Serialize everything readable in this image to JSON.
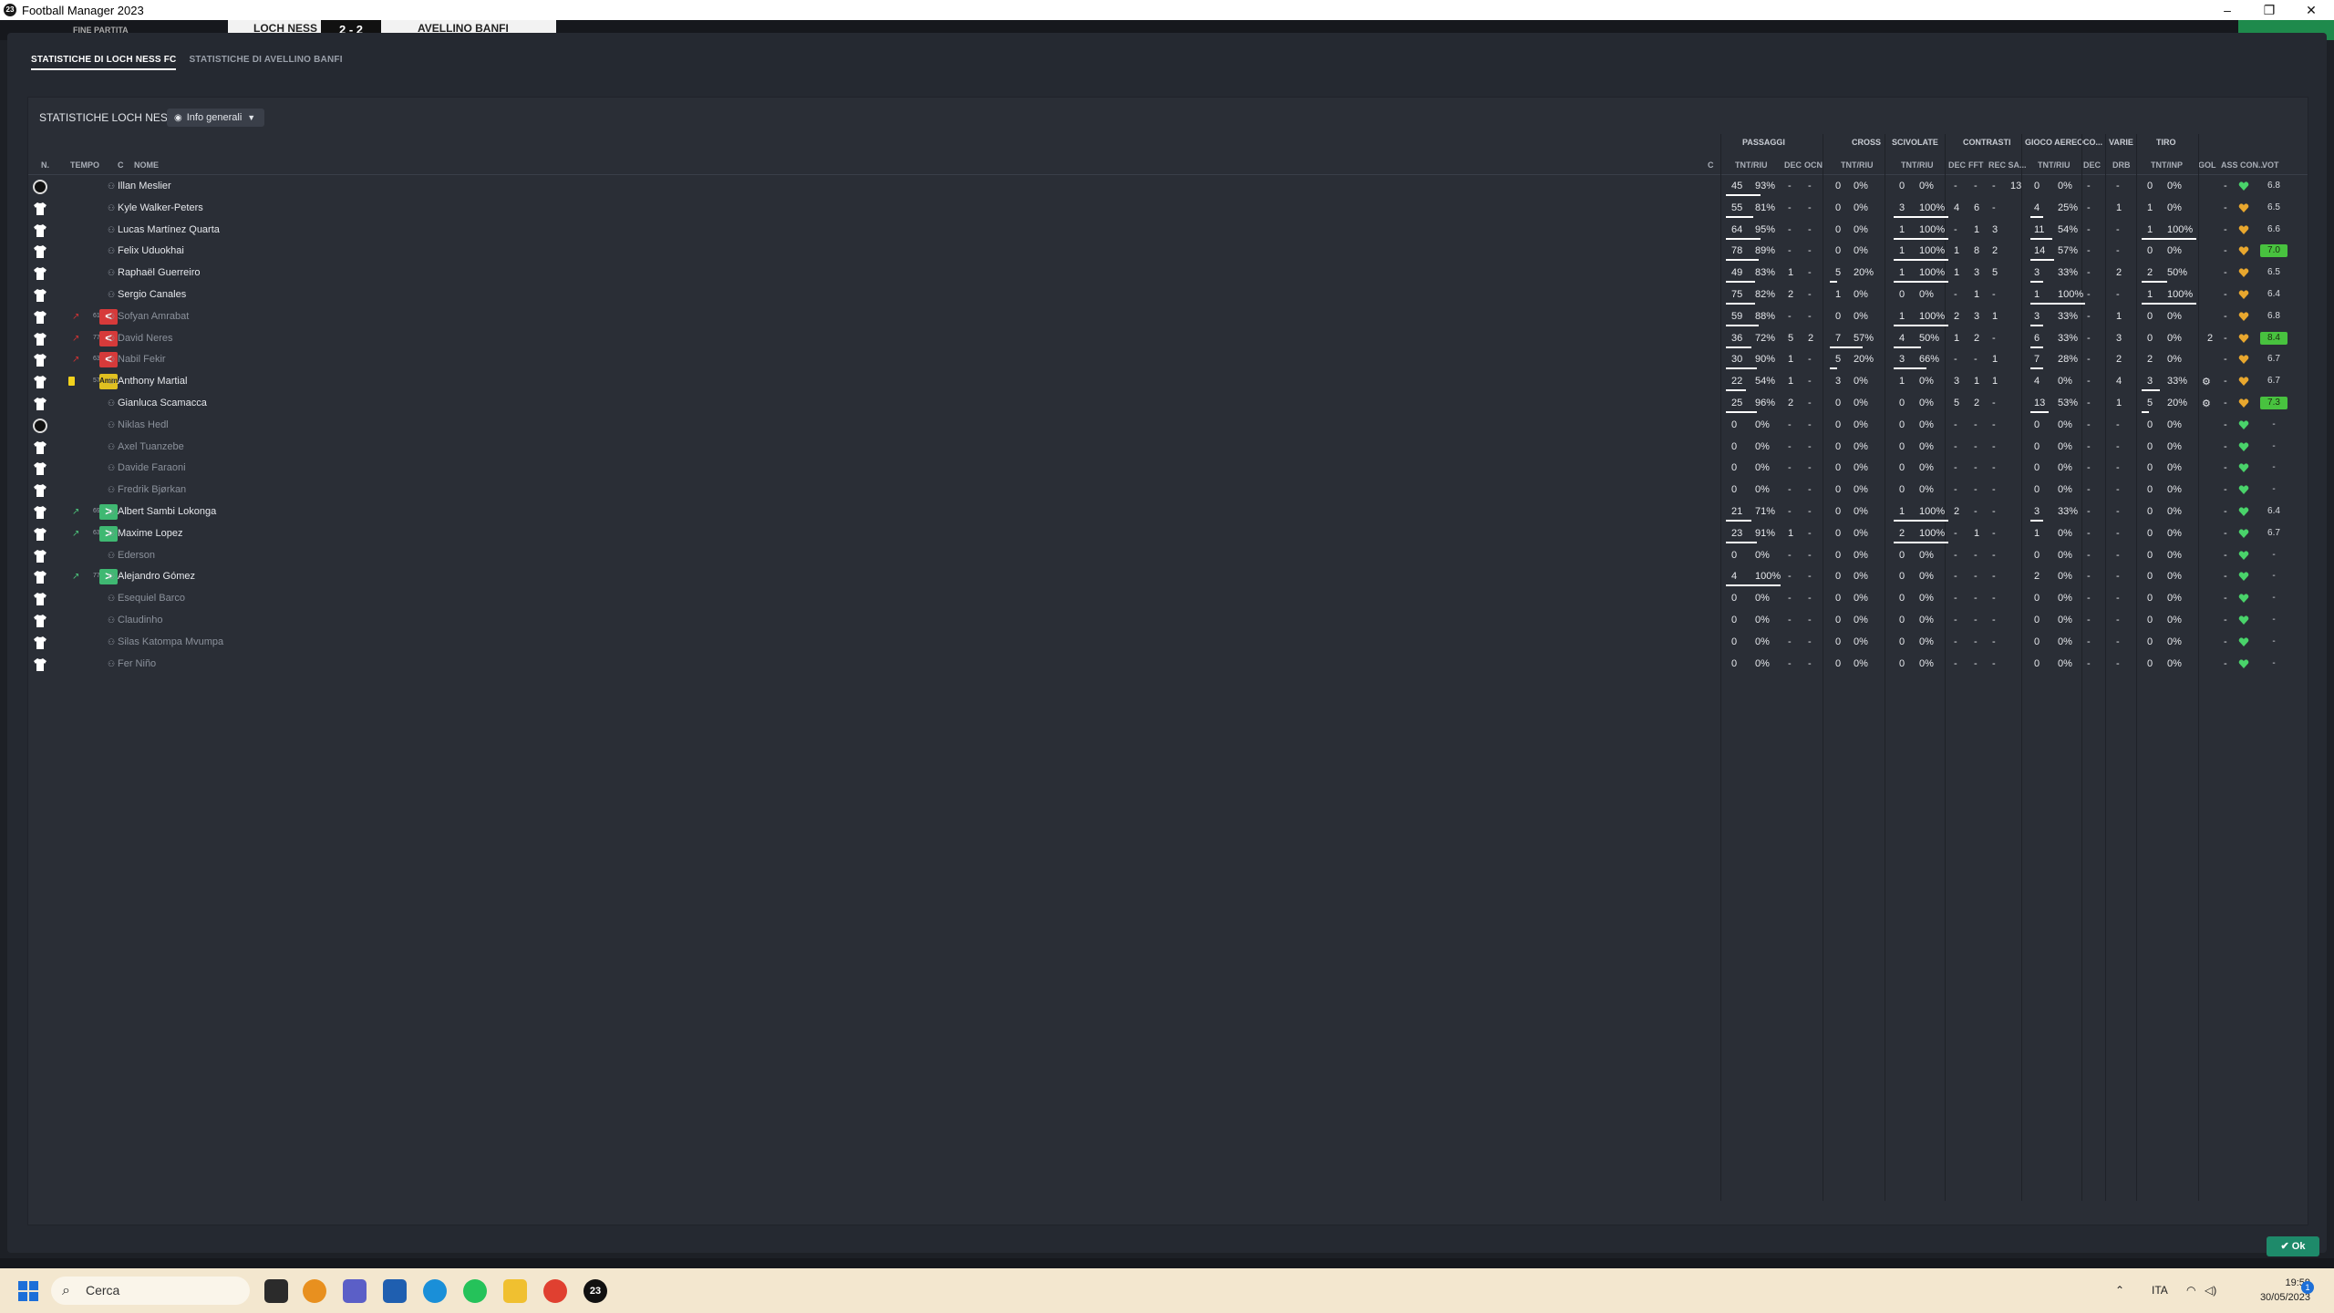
{
  "window": {
    "app_icon": "23",
    "title": "Football Manager 2023",
    "controls": {
      "minimize": "–",
      "restore": "❐",
      "close": "✕"
    }
  },
  "gamebar": {
    "left_label": "FINE PARTITA",
    "home_team": "LOCH NESS FC",
    "score": "2 - 2",
    "away_team": "AVELLINO BANFI"
  },
  "tabs": [
    {
      "label": "STATISTICHE DI LOCH NESS FC",
      "active": true
    },
    {
      "label": "STATISTICHE DI AVELLINO BANFI",
      "active": false
    }
  ],
  "panel": {
    "title": "STATISTICHE LOCH NESS FC",
    "view_dropdown": "Info generali"
  },
  "headers": {
    "left": {
      "n": "N.",
      "tempo": "TEMPO",
      "c": "C",
      "nome": "NOME",
      "c2": "C"
    },
    "groups": {
      "passaggi": "PASSAGGI",
      "cross": "CROSS",
      "scivolate": "SCIVOLATE",
      "contrasti": "CONTRASTI",
      "gioco_aereo": "GIOCO AEREO",
      "co": "CO...",
      "varie": "VARIE",
      "tiro": "TIRO"
    },
    "sub": {
      "pass_tnt": "TNT/RIU",
      "dec": "DEC",
      "ocn": "OCN",
      "cross_tnt": "TNT/RIU",
      "sciv_tnt": "TNT/RIU",
      "con_dec": "DEC",
      "fft": "FFT",
      "rec": "REC SA...",
      "aereo_tnt": "TNT/RIU",
      "co_dec": "DEC",
      "drb": "DRB",
      "tiro_tnt": "TNT/INP",
      "gol": "GOL",
      "ass": "ASS CON...",
      "vot": "VOT"
    }
  },
  "players": [
    {
      "name": "Illan Meslier",
      "gk": true,
      "pass": [
        "45",
        "93%"
      ],
      "dec": "-",
      "ocn": "-",
      "cross": [
        "0",
        "0%"
      ],
      "sciv": [
        "0",
        "0%"
      ],
      "con": [
        "-",
        "-",
        "-"
      ],
      "rec": "13",
      "aer": [
        "0",
        "0%"
      ],
      "codec": "-",
      "drb": "-",
      "tiro": [
        "0",
        "0%"
      ],
      "gol": "",
      "ass": "-",
      "vot": "6.8",
      "hi": false,
      "pw": 38,
      "cw": 0,
      "sw": 0,
      "aw": 0,
      "tw": 0
    },
    {
      "name": "Kyle Walker-Peters",
      "pass": [
        "55",
        "81%"
      ],
      "dec": "-",
      "ocn": "-",
      "cross": [
        "0",
        "0%"
      ],
      "sciv": [
        "3",
        "100%"
      ],
      "con": [
        "4",
        "6",
        "-"
      ],
      "rec": "",
      "aer": [
        "4",
        "25%"
      ],
      "codec": "-",
      "drb": "1",
      "tiro": [
        "1",
        "0%"
      ],
      "ass": "-",
      "vot": "6.5",
      "pw": 30,
      "sw": 60,
      "aw": 14
    },
    {
      "name": "Lucas Martínez Quarta",
      "pass": [
        "64",
        "95%"
      ],
      "dec": "-",
      "ocn": "-",
      "cross": [
        "0",
        "0%"
      ],
      "sciv": [
        "1",
        "100%"
      ],
      "con": [
        "-",
        "1",
        "3"
      ],
      "rec": "",
      "aer": [
        "11",
        "54%"
      ],
      "codec": "-",
      "drb": "-",
      "tiro": [
        "1",
        "100%"
      ],
      "ass": "-",
      "vot": "6.6",
      "pw": 38,
      "sw": 60,
      "aw": 24,
      "tw": 60
    },
    {
      "name": "Felix Uduokhai",
      "pass": [
        "78",
        "89%"
      ],
      "dec": "-",
      "ocn": "-",
      "cross": [
        "0",
        "0%"
      ],
      "sciv": [
        "1",
        "100%"
      ],
      "con": [
        "1",
        "8",
        "2"
      ],
      "rec": "",
      "aer": [
        "14",
        "57%"
      ],
      "codec": "-",
      "drb": "-",
      "tiro": [
        "0",
        "0%"
      ],
      "ass": "-",
      "vot": "7.0",
      "hi": true,
      "pw": 36,
      "sw": 60,
      "aw": 26
    },
    {
      "name": "Raphaël Guerreiro",
      "pass": [
        "49",
        "83%"
      ],
      "dec": "1",
      "ocn": "-",
      "cross": [
        "5",
        "20%"
      ],
      "sciv": [
        "1",
        "100%"
      ],
      "con": [
        "1",
        "3",
        "5"
      ],
      "rec": "",
      "aer": [
        "3",
        "33%"
      ],
      "codec": "-",
      "drb": "2",
      "tiro": [
        "2",
        "50%"
      ],
      "ass": "-",
      "vot": "6.5",
      "pw": 32,
      "cw": 8,
      "sw": 60,
      "aw": 14,
      "tw": 28
    },
    {
      "name": "Sergio Canales",
      "pass": [
        "75",
        "82%"
      ],
      "dec": "2",
      "ocn": "-",
      "cross": [
        "1",
        "0%"
      ],
      "sciv": [
        "0",
        "0%"
      ],
      "con": [
        "-",
        "1",
        "-"
      ],
      "rec": "",
      "aer": [
        "1",
        "100%"
      ],
      "codec": "-",
      "drb": "-",
      "tiro": [
        "1",
        "100%"
      ],
      "ass": "-",
      "vot": "6.4",
      "pw": 32,
      "aw": 60,
      "tw": 60
    },
    {
      "name": "Sofyan Amrabat",
      "dim": true,
      "role": "↗",
      "min": "61",
      "sub": "off",
      "pass": [
        "59",
        "88%"
      ],
      "dec": "-",
      "ocn": "-",
      "cross": [
        "0",
        "0%"
      ],
      "sciv": [
        "1",
        "100%"
      ],
      "con": [
        "2",
        "3",
        "1"
      ],
      "rec": "",
      "aer": [
        "3",
        "33%"
      ],
      "codec": "-",
      "drb": "1",
      "tiro": [
        "0",
        "0%"
      ],
      "ass": "-",
      "vot": "6.8",
      "pw": 36,
      "sw": 60,
      "aw": 14
    },
    {
      "name": "David Neres",
      "dim": true,
      "role": "↗",
      "min": "77",
      "sub": "off",
      "pass": [
        "36",
        "72%"
      ],
      "dec": "5",
      "ocn": "2",
      "cross": [
        "7",
        "57%"
      ],
      "sciv": [
        "4",
        "50%"
      ],
      "con": [
        "1",
        "2",
        "-"
      ],
      "rec": "",
      "aer": [
        "6",
        "33%"
      ],
      "codec": "-",
      "drb": "3",
      "tiro": [
        "0",
        "0%"
      ],
      "gol": "2",
      "ass": "-",
      "vot": "8.4",
      "hi": true,
      "pw": 28,
      "cw": 36,
      "sw": 30,
      "aw": 14
    },
    {
      "name": "Nabil Fekir",
      "dim": true,
      "role": "↗",
      "min": "63",
      "sub": "off",
      "pass": [
        "30",
        "90%"
      ],
      "dec": "1",
      "ocn": "-",
      "cross": [
        "5",
        "20%"
      ],
      "sciv": [
        "3",
        "66%"
      ],
      "con": [
        "-",
        "-",
        "1"
      ],
      "rec": "",
      "aer": [
        "7",
        "28%"
      ],
      "codec": "-",
      "drb": "2",
      "tiro": [
        "2",
        "0%"
      ],
      "ass": "-",
      "vot": "6.7",
      "pw": 34,
      "cw": 8,
      "sw": 36,
      "aw": 14
    },
    {
      "name": "Anthony Martial",
      "card": true,
      "min": "57",
      "sub": "ammo",
      "pass": [
        "22",
        "54%"
      ],
      "dec": "1",
      "ocn": "-",
      "cross": [
        "3",
        "0%"
      ],
      "sciv": [
        "1",
        "0%"
      ],
      "con": [
        "3",
        "1",
        "1"
      ],
      "rec": "",
      "aer": [
        "4",
        "0%"
      ],
      "codec": "-",
      "drb": "4",
      "tiro": [
        "3",
        "33%"
      ],
      "gear": true,
      "ass": "-",
      "vot": "6.7",
      "pw": 22,
      "tw": 20
    },
    {
      "name": "Gianluca Scamacca",
      "pass": [
        "25",
        "96%"
      ],
      "dec": "2",
      "ocn": "-",
      "cross": [
        "0",
        "0%"
      ],
      "sciv": [
        "0",
        "0%"
      ],
      "con": [
        "5",
        "2",
        "-"
      ],
      "rec": "",
      "aer": [
        "13",
        "53%"
      ],
      "codec": "-",
      "drb": "1",
      "tiro": [
        "5",
        "20%"
      ],
      "gear": true,
      "ass": "-",
      "vot": "7.3",
      "hi": true,
      "pw": 34,
      "aw": 20,
      "tw": 8
    },
    {
      "name": "Niklas Hedl",
      "dim": true,
      "gk": true,
      "pass": [
        "0",
        "0%"
      ],
      "dec": "-",
      "ocn": "-",
      "cross": [
        "0",
        "0%"
      ],
      "sciv": [
        "0",
        "0%"
      ],
      "con": [
        "-",
        "-",
        "-"
      ],
      "rec": "",
      "aer": [
        "0",
        "0%"
      ],
      "codec": "-",
      "drb": "-",
      "tiro": [
        "0",
        "0%"
      ],
      "ass": "-",
      "vot": "-"
    },
    {
      "name": "Axel Tuanzebe",
      "dim": true,
      "pass": [
        "0",
        "0%"
      ],
      "dec": "-",
      "ocn": "-",
      "cross": [
        "0",
        "0%"
      ],
      "sciv": [
        "0",
        "0%"
      ],
      "con": [
        "-",
        "-",
        "-"
      ],
      "rec": "",
      "aer": [
        "0",
        "0%"
      ],
      "codec": "-",
      "drb": "-",
      "tiro": [
        "0",
        "0%"
      ],
      "ass": "-",
      "vot": "-"
    },
    {
      "name": "Davide Faraoni",
      "dim": true,
      "pass": [
        "0",
        "0%"
      ],
      "dec": "-",
      "ocn": "-",
      "cross": [
        "0",
        "0%"
      ],
      "sciv": [
        "0",
        "0%"
      ],
      "con": [
        "-",
        "-",
        "-"
      ],
      "rec": "",
      "aer": [
        "0",
        "0%"
      ],
      "codec": "-",
      "drb": "-",
      "tiro": [
        "0",
        "0%"
      ],
      "ass": "-",
      "vot": "-"
    },
    {
      "name": "Fredrik Bjørkan",
      "dim": true,
      "pass": [
        "0",
        "0%"
      ],
      "dec": "-",
      "ocn": "-",
      "cross": [
        "0",
        "0%"
      ],
      "sciv": [
        "0",
        "0%"
      ],
      "con": [
        "-",
        "-",
        "-"
      ],
      "rec": "",
      "aer": [
        "0",
        "0%"
      ],
      "codec": "-",
      "drb": "-",
      "tiro": [
        "0",
        "0%"
      ],
      "ass": "-",
      "vot": "-"
    },
    {
      "name": "Albert Sambi Lokonga",
      "role": "↗",
      "rin": true,
      "min": "69",
      "sub": "on",
      "pass": [
        "21",
        "71%"
      ],
      "dec": "-",
      "ocn": "-",
      "cross": [
        "0",
        "0%"
      ],
      "sciv": [
        "1",
        "100%"
      ],
      "con": [
        "2",
        "-",
        "-"
      ],
      "rec": "",
      "aer": [
        "3",
        "33%"
      ],
      "codec": "-",
      "drb": "-",
      "tiro": [
        "0",
        "0%"
      ],
      "ass": "-",
      "vot": "6.4",
      "pw": 28,
      "sw": 60,
      "aw": 14
    },
    {
      "name": "Maxime Lopez",
      "role": "↗",
      "rin": true,
      "min": "63",
      "sub": "on",
      "pass": [
        "23",
        "91%"
      ],
      "dec": "1",
      "ocn": "-",
      "cross": [
        "0",
        "0%"
      ],
      "sciv": [
        "2",
        "100%"
      ],
      "con": [
        "-",
        "1",
        "-"
      ],
      "rec": "",
      "aer": [
        "1",
        "0%"
      ],
      "codec": "-",
      "drb": "-",
      "tiro": [
        "0",
        "0%"
      ],
      "ass": "-",
      "vot": "6.7",
      "pw": 34,
      "sw": 60
    },
    {
      "name": "Ederson",
      "dim": true,
      "pass": [
        "0",
        "0%"
      ],
      "dec": "-",
      "ocn": "-",
      "cross": [
        "0",
        "0%"
      ],
      "sciv": [
        "0",
        "0%"
      ],
      "con": [
        "-",
        "-",
        "-"
      ],
      "rec": "",
      "aer": [
        "0",
        "0%"
      ],
      "codec": "-",
      "drb": "-",
      "tiro": [
        "0",
        "0%"
      ],
      "ass": "-",
      "vot": "-"
    },
    {
      "name": "Alejandro Gómez",
      "role": "↗",
      "rin": true,
      "min": "77",
      "sub": "on",
      "pass": [
        "4",
        "100%"
      ],
      "dec": "-",
      "ocn": "-",
      "cross": [
        "0",
        "0%"
      ],
      "sciv": [
        "0",
        "0%"
      ],
      "con": [
        "-",
        "-",
        "-"
      ],
      "rec": "",
      "aer": [
        "2",
        "0%"
      ],
      "codec": "-",
      "drb": "-",
      "tiro": [
        "0",
        "0%"
      ],
      "ass": "-",
      "vot": "-",
      "pw": 60
    },
    {
      "name": "Esequiel Barco",
      "dim": true,
      "pass": [
        "0",
        "0%"
      ],
      "dec": "-",
      "ocn": "-",
      "cross": [
        "0",
        "0%"
      ],
      "sciv": [
        "0",
        "0%"
      ],
      "con": [
        "-",
        "-",
        "-"
      ],
      "rec": "",
      "aer": [
        "0",
        "0%"
      ],
      "codec": "-",
      "drb": "-",
      "tiro": [
        "0",
        "0%"
      ],
      "ass": "-",
      "vot": "-"
    },
    {
      "name": "Claudinho",
      "dim": true,
      "pass": [
        "0",
        "0%"
      ],
      "dec": "-",
      "ocn": "-",
      "cross": [
        "0",
        "0%"
      ],
      "sciv": [
        "0",
        "0%"
      ],
      "con": [
        "-",
        "-",
        "-"
      ],
      "rec": "",
      "aer": [
        "0",
        "0%"
      ],
      "codec": "-",
      "drb": "-",
      "tiro": [
        "0",
        "0%"
      ],
      "ass": "-",
      "vot": "-"
    },
    {
      "name": "Silas Katompa Mvumpa",
      "dim": true,
      "pass": [
        "0",
        "0%"
      ],
      "dec": "-",
      "ocn": "-",
      "cross": [
        "0",
        "0%"
      ],
      "sciv": [
        "0",
        "0%"
      ],
      "con": [
        "-",
        "-",
        "-"
      ],
      "rec": "",
      "aer": [
        "0",
        "0%"
      ],
      "codec": "-",
      "drb": "-",
      "tiro": [
        "0",
        "0%"
      ],
      "ass": "-",
      "vot": "-"
    },
    {
      "name": "Fer Niño",
      "dim": true,
      "pass": [
        "0",
        "0%"
      ],
      "dec": "-",
      "ocn": "-",
      "cross": [
        "0",
        "0%"
      ],
      "sciv": [
        "0",
        "0%"
      ],
      "con": [
        "-",
        "-",
        "-"
      ],
      "rec": "",
      "aer": [
        "0",
        "0%"
      ],
      "codec": "-",
      "drb": "-",
      "tiro": [
        "0",
        "0%"
      ],
      "ass": "-",
      "vot": "-"
    }
  ],
  "buttons": {
    "ok": "✔ Ok"
  },
  "taskbar": {
    "search_placeholder": "Cerca",
    "lang": "ITA",
    "time": "19:59",
    "date": "30/05/2023",
    "notif_count": "1"
  },
  "colors": {
    "accent_green": "#48c23f",
    "sub_off": "#d63a3a",
    "sub_on": "#3fb872",
    "yellow_card": "#f2d21d"
  }
}
